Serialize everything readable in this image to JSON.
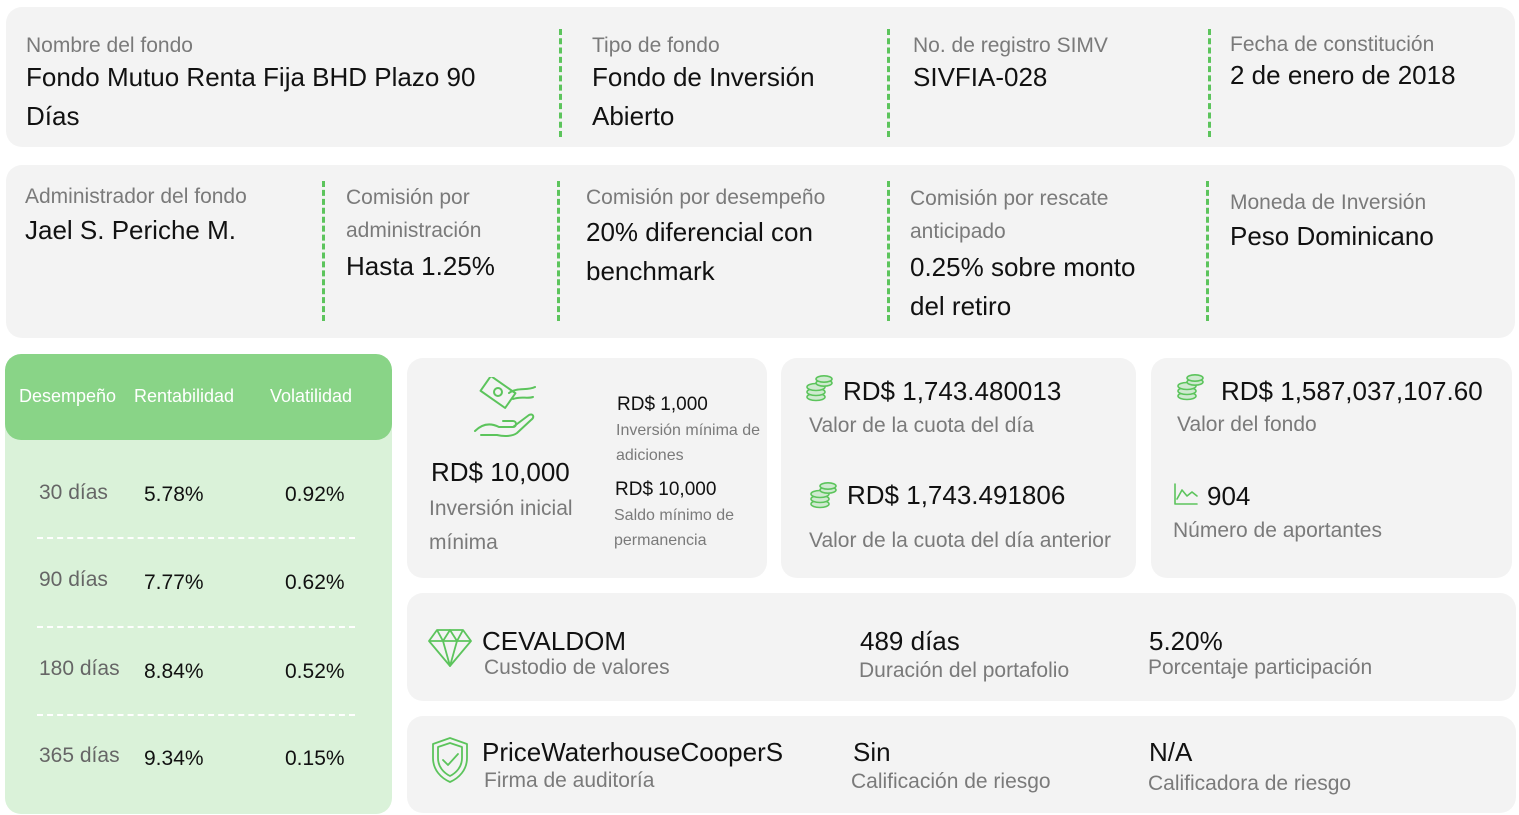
{
  "row1": {
    "nombre": {
      "label": "Nombre del fondo",
      "value_l1": "Fondo Mutuo Renta Fija BHD Plazo 90",
      "value_l2": "Días"
    },
    "tipo": {
      "label": "Tipo de fondo",
      "value_l1": "Fondo de Inversión",
      "value_l2": "Abierto"
    },
    "registro": {
      "label": "No. de registro SIMV",
      "value": "SIVFIA-028"
    },
    "fecha": {
      "label": "Fecha de constitución",
      "value": "2 de enero de 2018"
    }
  },
  "row2": {
    "administrador": {
      "label": "Administrador del fondo",
      "value": "Jael S. Periche M."
    },
    "comision_admin": {
      "label_l1": "Comisión por",
      "label_l2": "administración",
      "value": "Hasta 1.25%"
    },
    "comision_desempeno": {
      "label": "Comisión por desempeño",
      "value_l1": "20% diferencial con",
      "value_l2": "benchmark"
    },
    "comision_rescate": {
      "label_l1": "Comisión por rescate",
      "label_l2": "anticipado",
      "value_l1": "0.25% sobre monto",
      "value_l2": "del retiro"
    },
    "moneda": {
      "label": "Moneda de Inversión",
      "value": "Peso Dominicano"
    }
  },
  "performance": {
    "headers": [
      "Desempeño",
      "Rentabilidad",
      "Volatilidad"
    ],
    "rows": [
      {
        "period": "30 días",
        "rentabilidad": "5.78%",
        "volatilidad": "0.92%"
      },
      {
        "period": "90 días",
        "rentabilidad": "7.77%",
        "volatilidad": "0.62%"
      },
      {
        "period": "180 días",
        "rentabilidad": "8.84%",
        "volatilidad": "0.52%"
      },
      {
        "period": "365 días",
        "rentabilidad": "9.34%",
        "volatilidad": "0.15%"
      }
    ]
  },
  "inversion": {
    "inicial_value": "RD$ 10,000",
    "inicial_label_l1": "Inversión inicial",
    "inicial_label_l2": "mínima",
    "adiciones_value": "RD$ 1,000",
    "adiciones_label_l1": "Inversión mínima de",
    "adiciones_label_l2": "adiciones",
    "saldo_value": "RD$ 10,000",
    "saldo_label_l1": "Saldo mínimo de",
    "saldo_label_l2": "permanencia"
  },
  "cuota": {
    "dia_value": "RD$ 1,743.480013",
    "dia_label": "Valor de la cuota del día",
    "anterior_value": "RD$ 1,743.491806",
    "anterior_label": "Valor de la cuota del día anterior"
  },
  "fondo": {
    "valor_value": "RD$ 1,587,037,107.60",
    "valor_label": "Valor del fondo",
    "aportantes_value": "904",
    "aportantes_label": "Número de aportantes"
  },
  "custodio": {
    "value": "CEVALDOM",
    "label": "Custodio de valores",
    "duracion_value": "489 días",
    "duracion_label": "Duración del portafolio",
    "participacion_value": "5.20%",
    "participacion_label": "Porcentaje participación"
  },
  "auditoria": {
    "value": "PriceWaterhouseCooperS",
    "label": "Firma de auditoría",
    "calificacion_value": "Sin",
    "calificacion_label": "Calificación de riesgo",
    "calificadora_value": "N/A",
    "calificadora_label": "Calificadora de riesgo"
  },
  "colors": {
    "accent": "#5cc45c",
    "header_green": "#89d487",
    "table_bg": "#daf2d9",
    "card_bg": "#f3f3f3"
  },
  "icons": [
    "money-hand-icon",
    "coins-icon",
    "chart-line-icon",
    "diamond-icon",
    "shield-check-icon"
  ]
}
